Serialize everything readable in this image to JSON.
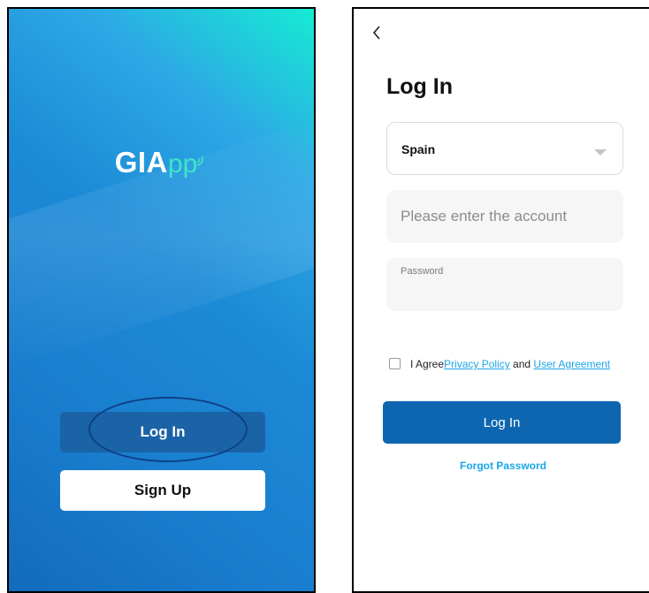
{
  "welcome_screen": {
    "logo": {
      "main": "GIA",
      "accent": "pp",
      "wave_icon": "signal-wave-icon"
    },
    "login_button": "Log In",
    "signup_button": "Sign Up",
    "colors": {
      "gradient_top": "#16ebd3",
      "gradient_bottom": "#136bbd",
      "login_bg": "#1a63a6",
      "highlight_ellipse": "#0e3f86"
    }
  },
  "login_screen": {
    "back_icon": "chevron-left-icon",
    "title": "Log In",
    "country": {
      "value": "Spain",
      "icon": "caret-down-icon"
    },
    "account": {
      "placeholder": "Please enter the account"
    },
    "password": {
      "label": "Password"
    },
    "agreement": {
      "prefix": "I Agree",
      "privacy_link": "Privacy Policy",
      "joiner": " and ",
      "user_agreement_link": "User Agreement"
    },
    "login_button": "Log In",
    "forgot_password": "Forgot Password",
    "colors": {
      "primary": "#0e66b1",
      "link": "#1aa6e8"
    }
  }
}
